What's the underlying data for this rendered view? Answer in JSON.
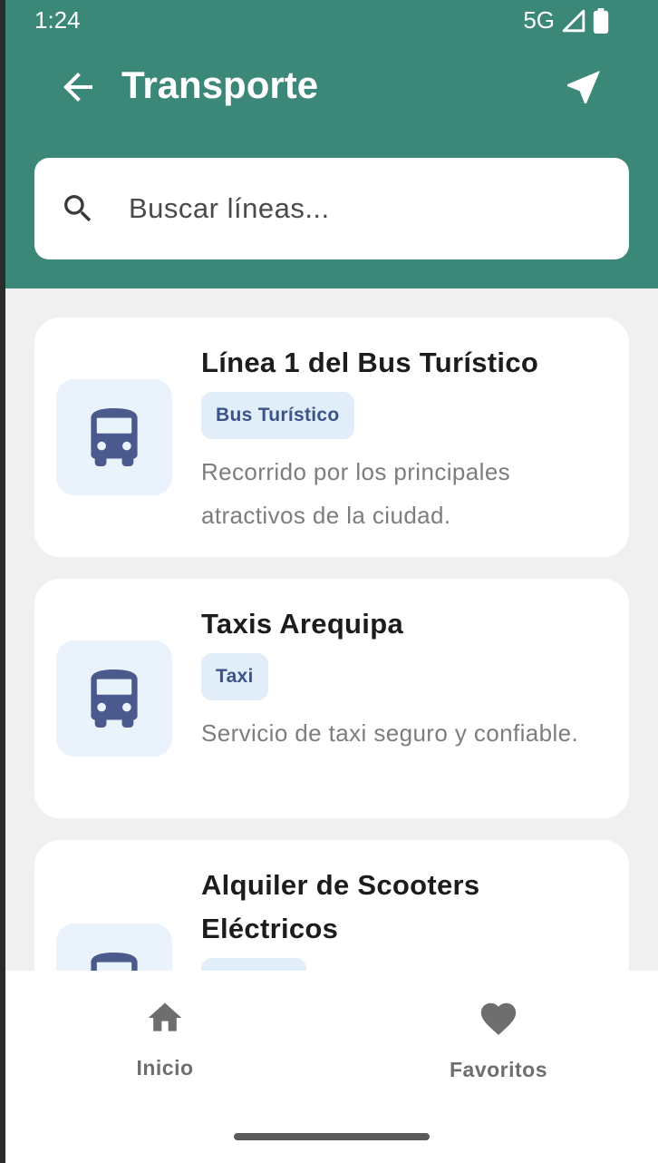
{
  "status_bar": {
    "time": "1:24",
    "network": "5G"
  },
  "header": {
    "title": "Transporte"
  },
  "search": {
    "placeholder": "Buscar líneas..."
  },
  "items": [
    {
      "title": "Línea 1 del Bus Turístico",
      "badge": "Bus Turístico",
      "description": "Recorrido por los principales atractivos de la ciudad.",
      "icon": "bus-icon"
    },
    {
      "title": "Taxis Arequipa",
      "badge": "Taxi",
      "description": "Servicio de taxi seguro y confiable.",
      "icon": "bus-icon"
    },
    {
      "title": "Alquiler de Scooters Eléctricos",
      "badge": "",
      "description": "",
      "icon": "bus-icon"
    }
  ],
  "bottom_nav": [
    {
      "label": "Inicio",
      "icon": "home-icon"
    },
    {
      "label": "Favoritos",
      "icon": "heart-icon"
    }
  ],
  "colors": {
    "primary": "#3c8878",
    "icon_blue": "#4b5a8c",
    "badge_bg": "#e1edf9",
    "badge_text": "#3b5488"
  }
}
